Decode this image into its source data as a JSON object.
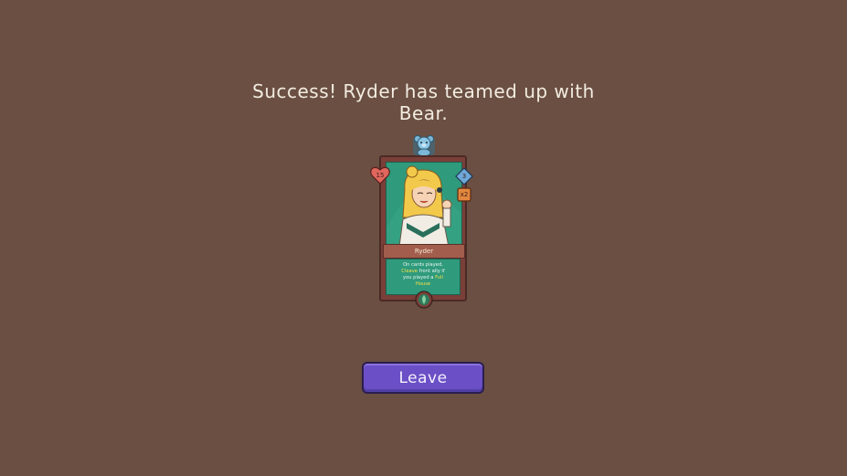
{
  "message": {
    "line1": "Success! Ryder has teamed up with",
    "line2": "Bear."
  },
  "card": {
    "name": "Ryder",
    "health": "15",
    "attack": "3",
    "counter": "x2",
    "description": {
      "part1": "On cards played,",
      "part2_hl": "Cleave",
      "part2": " front ally if",
      "part3": "you played a ",
      "part3_hl": "Full",
      "part4_hl": "House"
    },
    "companion_icon": "bear-icon",
    "bottom_icon": "leaf-gem-icon"
  },
  "actions": {
    "leave_label": "Leave"
  },
  "colors": {
    "background": "#6a4f42",
    "button": "#6a4fc6",
    "card_frame": "#7a3f38",
    "card_art": "#2f9a7c",
    "highlight": "#f4e04a"
  }
}
